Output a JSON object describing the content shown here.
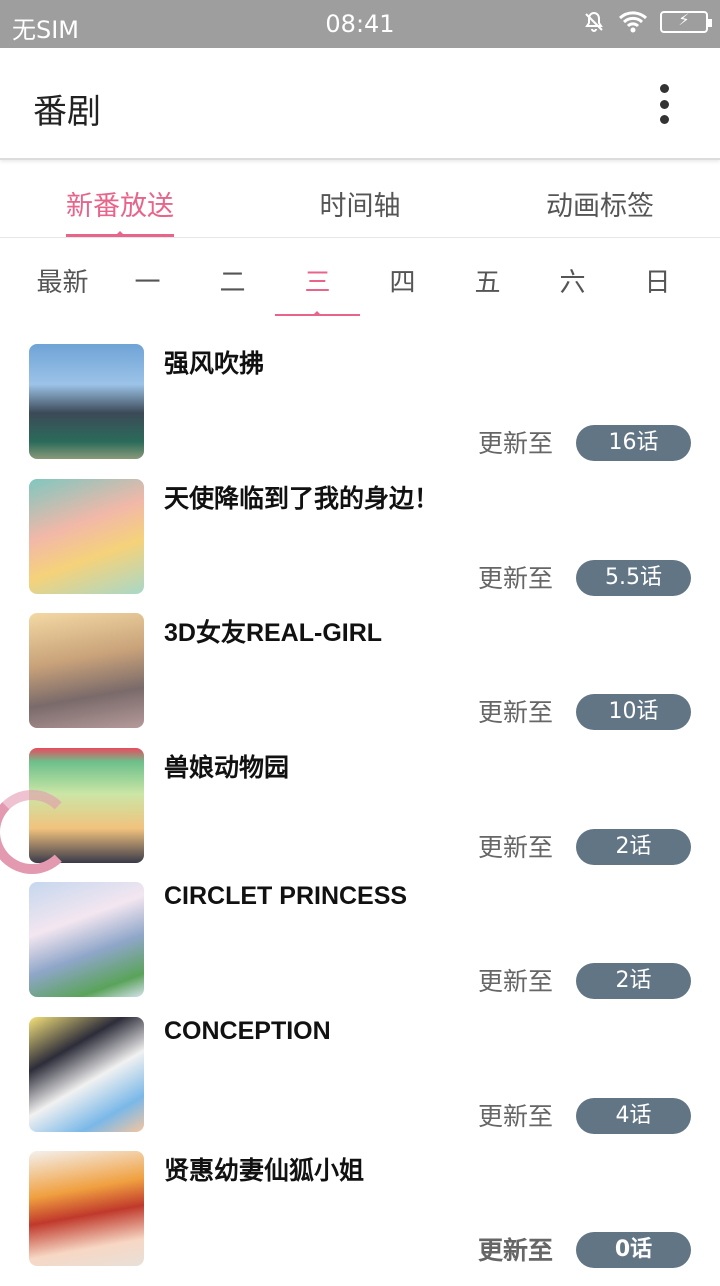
{
  "status_bar": {
    "carrier": "无SIM",
    "time": "08:41",
    "icons": [
      "mute-bell-icon",
      "wifi-icon",
      "battery-charging-icon"
    ]
  },
  "app_bar": {
    "title": "番剧",
    "menu_icon": "more-vertical-icon"
  },
  "tabs": [
    {
      "label": "新番放送",
      "active": true
    },
    {
      "label": "时间轴",
      "active": false
    },
    {
      "label": "动画标签",
      "active": false
    }
  ],
  "days": [
    {
      "label": "最新"
    },
    {
      "label": "一"
    },
    {
      "label": "二"
    },
    {
      "label": "三",
      "active": true
    },
    {
      "label": "四"
    },
    {
      "label": "五"
    },
    {
      "label": "六"
    },
    {
      "label": "日"
    }
  ],
  "items": [
    {
      "title": "强风吹拂",
      "update_label": "更新至",
      "episode": "16话"
    },
    {
      "title": "天使降临到了我的身边！",
      "update_label": "更新至",
      "episode": "5.5话"
    },
    {
      "title": "3D女友REAL-GIRL",
      "update_label": "更新至",
      "episode": "10话"
    },
    {
      "title": "兽娘动物园",
      "update_label": "更新至",
      "episode": "2话"
    },
    {
      "title": "CIRCLET PRINCESS",
      "update_label": "更新至",
      "episode": "2话"
    },
    {
      "title": "CONCEPTION",
      "update_label": "更新至",
      "episode": "4话"
    },
    {
      "title": "贤惠幼妻仙狐小姐",
      "update_label": "更新至",
      "episode": "0话"
    }
  ],
  "colors": {
    "accent": "#e8648a",
    "episode_badge": "#627585",
    "status_bar": "#9e9e9e"
  }
}
